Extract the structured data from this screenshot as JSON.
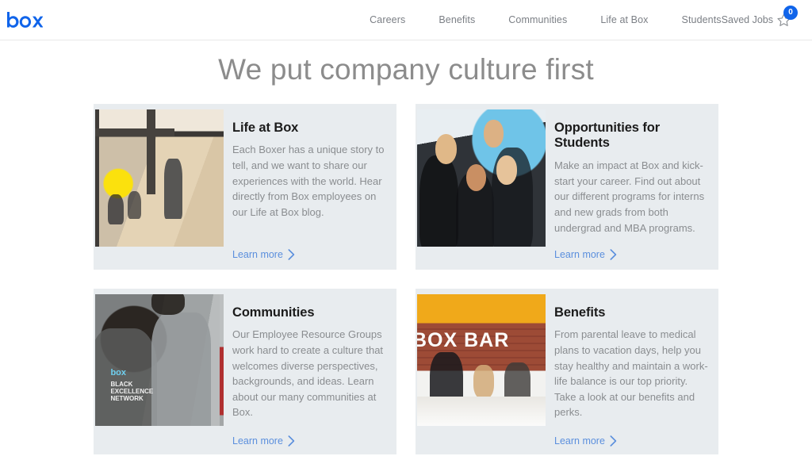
{
  "header": {
    "logo_alt": "box",
    "logo_color": "#1064ea",
    "nav_items": [
      {
        "label": "Careers"
      },
      {
        "label": "Benefits"
      },
      {
        "label": "Communities"
      },
      {
        "label": "Life at Box"
      },
      {
        "label": "Students"
      }
    ],
    "saved_jobs": {
      "label": "Saved Jobs",
      "count": "0",
      "badge_color": "#1064ea",
      "icon": "star-outline-icon"
    }
  },
  "page": {
    "title": "We put company culture first",
    "title_color": "#8c8c8c",
    "card_bg": "#e8ecef",
    "link_color": "#5b8fdd"
  },
  "cards": [
    {
      "title": "Life at Box",
      "description": "Each Boxer has a unique story to tell, and we want to share our experiences with the world. Hear directly from Box employees on our Life at Box blog.",
      "link_label": "Learn more",
      "image_alt": "Boxers working and relaxing in a bright office lounge with yellow chairs"
    },
    {
      "title": "Opportunities for Students",
      "description": "Make an impact at Box and kick-start your career. Find out about our different programs for interns and new grads from both undergrad and MBA programs.",
      "link_label": "Learn more",
      "image_alt": "Four smiling students in black Box t-shirts posing together"
    },
    {
      "title": "Communities",
      "description": "Our Employee Resource Groups work hard to create a culture that welcomes diverse perspectives, backgrounds, and ideas. Learn about our many communities at Box.",
      "link_label": "Learn more",
      "image_alt": "Two employees seen from behind wearing box BLACK EXCELLENCE NETWORK shirts"
    },
    {
      "title": "Benefits",
      "description": "From parental leave to medical plans to vacation days, help you stay healthy and maintain a work-life balance is our top priority. Take a look at our benefits and perks.",
      "link_label": "Learn more",
      "image_alt": "The BOX BAR cafe with a neon sign over an exposed brick wall",
      "image_overlay_text": "BOX BAR"
    }
  ]
}
